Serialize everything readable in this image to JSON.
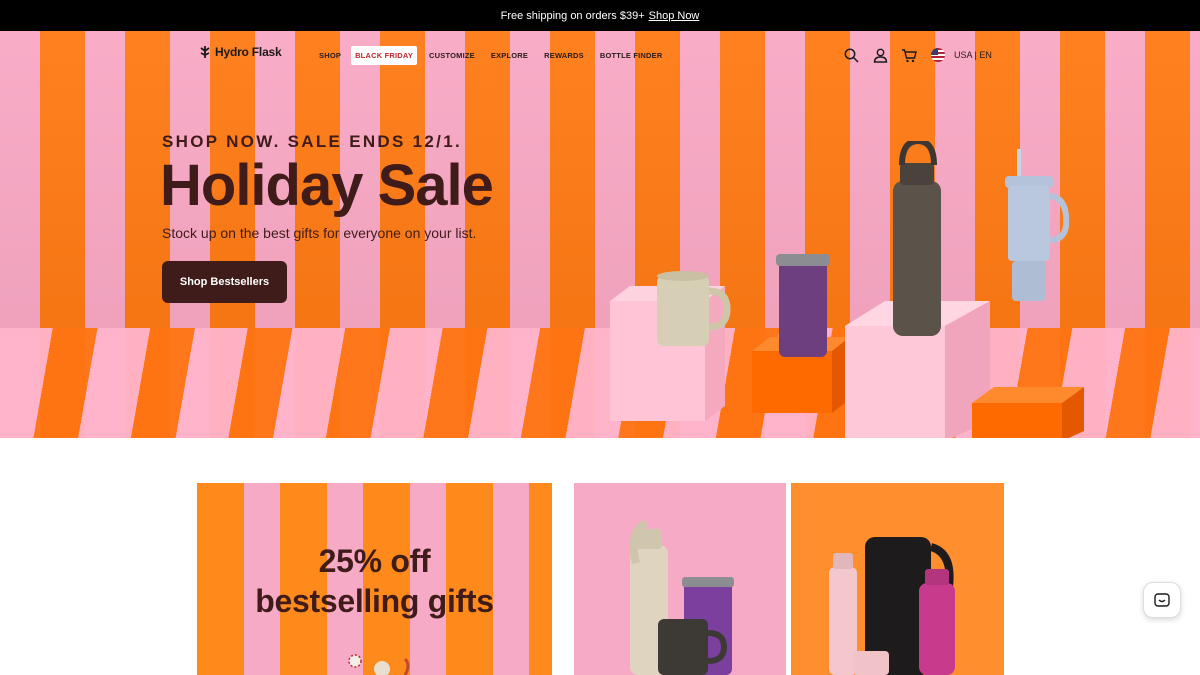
{
  "announcement": {
    "text": "Free shipping on orders $39+",
    "link": "Shop Now"
  },
  "nav": {
    "logo": "Hydro Flask",
    "links": [
      "SHOP",
      "BLACK FRIDAY",
      "CUSTOMIZE",
      "EXPLORE",
      "REWARDS",
      "BOTTLE FINDER"
    ],
    "icons": [
      "search-icon",
      "account-icon",
      "cart-icon",
      "flag-icon"
    ],
    "locale": "USA | EN"
  },
  "hero": {
    "eyebrow": "SHOP NOW. SALE ENDS 12/1.",
    "title": "Holiday Sale",
    "subtitle": "Stock up on the best gifts for everyone on your list.",
    "cta": "Shop Bestsellers"
  },
  "cards": [
    {
      "title_line1": "25% off",
      "title_line2": "bestselling gifts"
    }
  ],
  "colors": {
    "brand_dark": "#3f1c1a",
    "pink": "#f9a8c4",
    "orange": "#ff7a14",
    "black_friday_red": "#c1272d"
  },
  "chat": {
    "icon": "chat-smile-icon"
  }
}
